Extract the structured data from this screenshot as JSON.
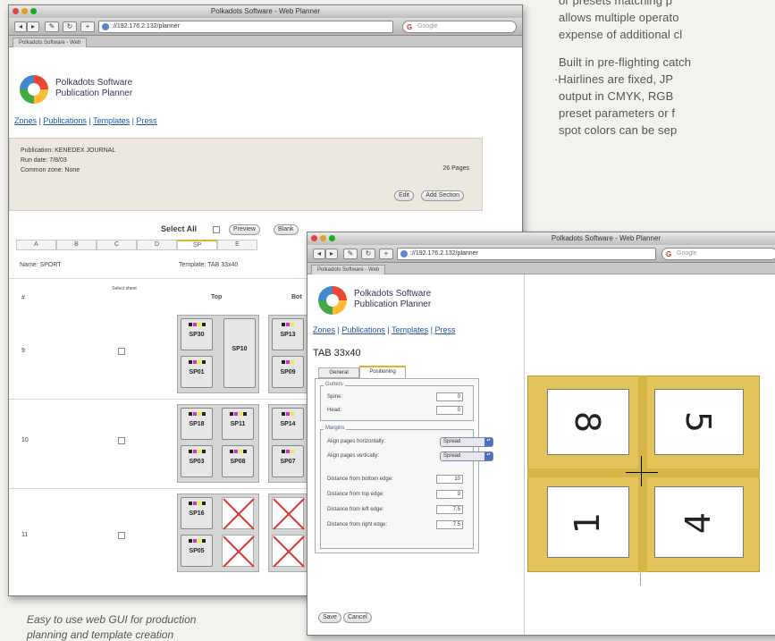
{
  "article": {
    "line1": "or presets matching p",
    "line2": "allows multiple operato",
    "line3": "expense of additional cl",
    "line4": "Built in pre-flighting catch",
    "line5": "·Hairlines are fixed, JP",
    "line6": "output in CMYK, RGB",
    "line7": "preset parameters or f",
    "line8": "spot colors can be sep",
    "caption1": "Easy to use web GUI for production",
    "caption2": "planning and template creation"
  },
  "win1": {
    "title": "Polkadots Software - Web Planner",
    "url": "://192.176.2.132/planner",
    "search_placeholder": "Google",
    "tab": "Polkadots Software - Web",
    "logo_line1": "Polkadots Software",
    "logo_line2": "Publication Planner",
    "nav": {
      "zones": "Zones",
      "publications": "Publications",
      "templates": "Templates",
      "press": "Press",
      "sep": "|"
    },
    "pub": {
      "publication": "Publication: KENEDEX JOURNAL",
      "run_date": "Run date: 7/8/03",
      "common_zone": "Common zone: None",
      "pages": "26 Pages",
      "edit": "Edit",
      "add_section": "Add Section"
    },
    "select_all": "Select All",
    "btn_preview": "Preview",
    "btn_blank": "Blank",
    "tabs": [
      "A",
      "B",
      "C",
      "D",
      "SP",
      "E"
    ],
    "name_label": "Name: SPORT",
    "template_label": "Template: TAB 33x40",
    "col_hash": "#",
    "col_select": "Select sheet",
    "col_top": "Top",
    "col_bottom": "Bot",
    "rows": [
      {
        "num": "9",
        "pages": [
          "SP30",
          "SP10",
          "SP01"
        ],
        "right": [
          "SP13",
          "SP09"
        ]
      },
      {
        "num": "10",
        "pages": [
          "SP18",
          "SP11",
          "SP03",
          "SP08"
        ],
        "right": [
          "SP14",
          "SP07"
        ]
      },
      {
        "num": "11",
        "pages": [
          "SP16",
          "SP05"
        ],
        "right": []
      }
    ]
  },
  "win2": {
    "title": "Polkadots Software - Web Planner",
    "url": "://192.176.2.132/planner",
    "search_placeholder": "Google",
    "tab": "Polkadots Software - Web",
    "logo_line1": "Polkadots Software",
    "logo_line2": "Publication Planner",
    "nav": {
      "zones": "Zones",
      "publications": "Publications",
      "templates": "Templates",
      "press": "Press",
      "sep": "|"
    },
    "template_name": "TAB 33x40",
    "tab_general": "General",
    "tab_positioning": "Positioning",
    "gutters_legend": "Gutters",
    "spine_label": "Spine:",
    "spine_value": "0",
    "head_label": "Head:",
    "head_value": "0",
    "margins_legend": "Margins",
    "align_h_label": "Align pages horizontally:",
    "align_h_value": "Spread",
    "align_v_label": "Align pages vertically:",
    "align_v_value": "Spread",
    "dist_bottom_label": "Distance from bottom edge:",
    "dist_bottom_value": "10",
    "dist_top_label": "Distance from top edge:",
    "dist_top_value": "0",
    "dist_left_label": "Distance from left edge:",
    "dist_left_value": "7.5",
    "dist_right_label": "Distance from right edge:",
    "dist_right_value": "7.5",
    "save": "Save",
    "cancel": "Cancel",
    "preview_pages": [
      "8",
      "5",
      "1",
      "4"
    ],
    "preview_color": "#e2c45a"
  },
  "colors": {
    "accent": "#2254a8",
    "sheet": "#e2c45a",
    "mark": "#c0392b"
  }
}
